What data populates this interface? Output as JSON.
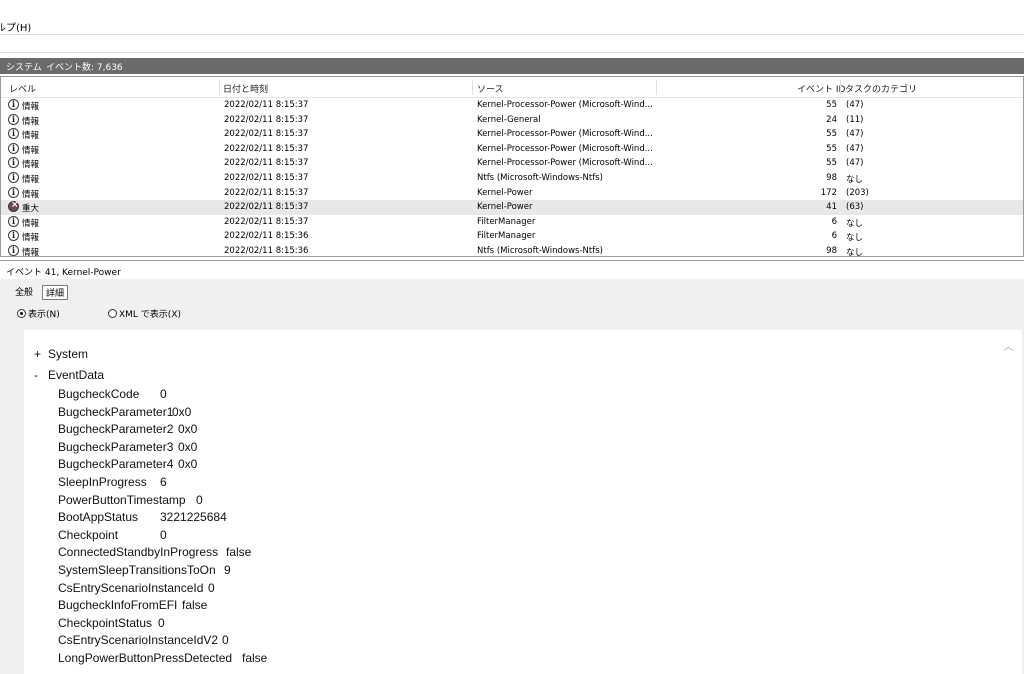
{
  "menu": {
    "help": "ルプ(H)"
  },
  "title_bar": {
    "log_name": "システム",
    "event_count": "イベント数: 7,636"
  },
  "table": {
    "headers": {
      "level": "レベル",
      "datetime": "日付と時刻",
      "source": "ソース",
      "event_id": "イベント ID",
      "task": "タスクのカテゴリ"
    },
    "rows": [
      {
        "icon": "info",
        "level": "情報",
        "datetime": "2022/02/11 8:15:37",
        "source": "Kernel-Processor-Power (Microsoft-Wind...",
        "event_id": "55",
        "task": "(47)"
      },
      {
        "icon": "info",
        "level": "情報",
        "datetime": "2022/02/11 8:15:37",
        "source": "Kernel-General",
        "event_id": "24",
        "task": "(11)"
      },
      {
        "icon": "info",
        "level": "情報",
        "datetime": "2022/02/11 8:15:37",
        "source": "Kernel-Processor-Power (Microsoft-Wind...",
        "event_id": "55",
        "task": "(47)"
      },
      {
        "icon": "info",
        "level": "情報",
        "datetime": "2022/02/11 8:15:37",
        "source": "Kernel-Processor-Power (Microsoft-Wind...",
        "event_id": "55",
        "task": "(47)"
      },
      {
        "icon": "info",
        "level": "情報",
        "datetime": "2022/02/11 8:15:37",
        "source": "Kernel-Processor-Power (Microsoft-Wind...",
        "event_id": "55",
        "task": "(47)"
      },
      {
        "icon": "info",
        "level": "情報",
        "datetime": "2022/02/11 8:15:37",
        "source": "Ntfs (Microsoft-Windows-Ntfs)",
        "event_id": "98",
        "task": "なし"
      },
      {
        "icon": "info",
        "level": "情報",
        "datetime": "2022/02/11 8:15:37",
        "source": "Kernel-Power",
        "event_id": "172",
        "task": "(203)"
      },
      {
        "icon": "critical",
        "level": "重大",
        "datetime": "2022/02/11 8:15:37",
        "source": "Kernel-Power",
        "event_id": "41",
        "task": "(63)"
      },
      {
        "icon": "info",
        "level": "情報",
        "datetime": "2022/02/11 8:15:37",
        "source": "FilterManager",
        "event_id": "6",
        "task": "なし"
      },
      {
        "icon": "info",
        "level": "情報",
        "datetime": "2022/02/11 8:15:36",
        "source": "FilterManager",
        "event_id": "6",
        "task": "なし"
      },
      {
        "icon": "info",
        "level": "情報",
        "datetime": "2022/02/11 8:15:36",
        "source": "Ntfs (Microsoft-Windows-Ntfs)",
        "event_id": "98",
        "task": "なし"
      }
    ]
  },
  "detail": {
    "header": "イベント 41, Kernel-Power",
    "tabs": {
      "general": "全般",
      "details": "詳細"
    },
    "radio": {
      "friendly": "表示(N)",
      "xml": "XML で表示(X)"
    },
    "tree": {
      "system": {
        "toggle": "+",
        "label": "System"
      },
      "eventdata": {
        "toggle": "-",
        "label": "EventData"
      }
    },
    "fields": [
      {
        "name": "BugcheckCode",
        "value": "0"
      },
      {
        "name": "BugcheckParameter1",
        "value": "0x0"
      },
      {
        "name": "BugcheckParameter2",
        "value": "0x0"
      },
      {
        "name": "BugcheckParameter3",
        "value": "0x0"
      },
      {
        "name": "BugcheckParameter4",
        "value": "0x0"
      },
      {
        "name": "SleepInProgress",
        "value": "6"
      },
      {
        "name": "PowerButtonTimestamp",
        "value": "0"
      },
      {
        "name": "BootAppStatus",
        "value": "3221225684"
      },
      {
        "name": "Checkpoint",
        "value": "0"
      },
      {
        "name": "ConnectedStandbyInProgress",
        "value": "false"
      },
      {
        "name": "SystemSleepTransitionsToOn",
        "value": "9"
      },
      {
        "name": "CsEntryScenarioInstanceId",
        "value": "0"
      },
      {
        "name": "BugcheckInfoFromEFI",
        "value": "false"
      },
      {
        "name": "CheckpointStatus",
        "value": "0"
      },
      {
        "name": "CsEntryScenarioInstanceIdV2",
        "value": "0"
      },
      {
        "name": "LongPowerButtonPressDetected",
        "value": "false"
      }
    ]
  }
}
